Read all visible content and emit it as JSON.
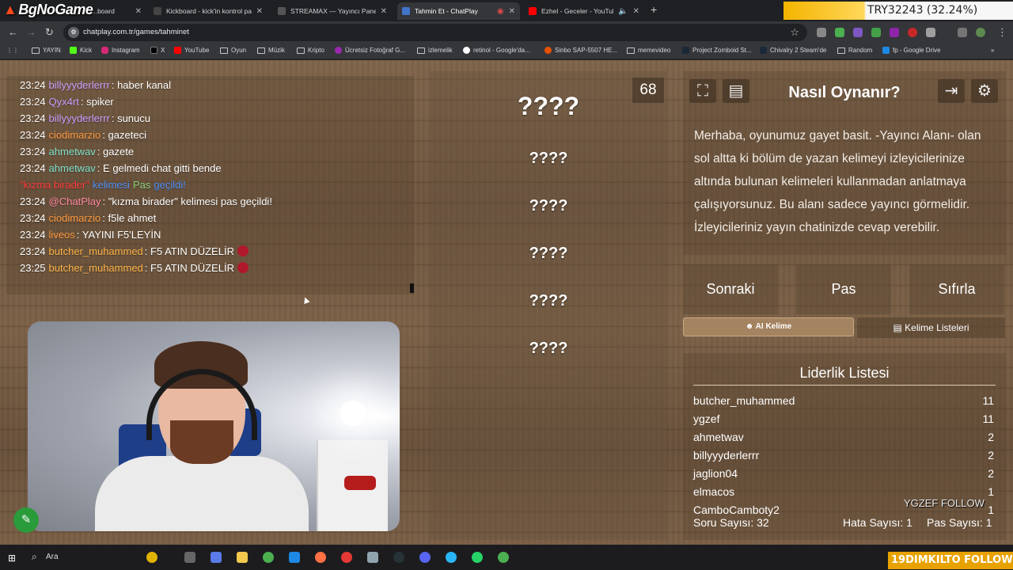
{
  "stream": {
    "brand": "BgNoGame",
    "ticker": "TRY32243 (32.24%)",
    "follow_bar": "19DIMKILTO  FOLLOW",
    "follow_overlay": [
      "YGZEF  FOLLOW"
    ]
  },
  "browser": {
    "tabs": [
      {
        "label": "...board",
        "active": false
      },
      {
        "label": "Kickboard - kick'in kontrol pan",
        "active": false
      },
      {
        "label": "STREAMAX — Yayıncı Paneli",
        "active": false
      },
      {
        "label": "Tahmin Et - ChatPlay",
        "active": true
      },
      {
        "label": "Ezhel - Geceler - YouTube",
        "active": false
      }
    ],
    "url": "chatplay.com.tr/games/tahminet",
    "bookmarks": [
      "YAYIN",
      "Kick",
      "Instagram",
      "X",
      "YouTube",
      "Oyun",
      "Müzik",
      "Kripto",
      "Ücretsiz Fotoğraf G...",
      "izlemelik",
      "retinol - Google'da...",
      "Sinbo SAP-5507 HE...",
      "memevideo",
      "Project Zomboid St...",
      "Chivalry 2 Steam'de",
      "Random",
      "fp - Google Drive"
    ]
  },
  "chat": {
    "messages": [
      {
        "time": "23:24",
        "user": "billyyyderlerrr",
        "color": "#c9a0ff",
        "text": "haber kanal"
      },
      {
        "time": "23:24",
        "user": "Qyx4rt",
        "color": "#c9a0ff",
        "text": "spiker"
      },
      {
        "time": "23:24",
        "user": "billyyyderlerrr",
        "color": "#c9a0ff",
        "text": "sunucu"
      },
      {
        "time": "23:24",
        "user": "ciodimarzio",
        "color": "#ff9b3f",
        "text": "gazeteci"
      },
      {
        "time": "23:24",
        "user": "ahmetwav",
        "color": "#7ee2c9",
        "text": "gazete"
      },
      {
        "time": "23:24",
        "user": "ahmetwav",
        "color": "#7ee2c9",
        "text": "E gelmedi chat gitti bende"
      },
      {
        "system": true,
        "word": "\"kızma birader\"",
        "mid": "kelimesi",
        "status": "Pas",
        "end": "geçildi!"
      },
      {
        "time": "23:24",
        "user": "@ChatPlay",
        "color": "#ff8aa0",
        "text": "\"kızma birader\" kelimesi pas geçildi!"
      },
      {
        "time": "23:24",
        "user": "ciodimarzio",
        "color": "#ff9b3f",
        "text": "f5le ahmet"
      },
      {
        "time": "23:24",
        "user": "liveos",
        "color": "#ff9b3f",
        "text": "YAYINI F5'LEYİN"
      },
      {
        "time": "23:24",
        "user": "butcher_muhammed",
        "color": "#ffb347",
        "text": "F5 ATIN DÜZELİR"
      },
      {
        "time": "23:25",
        "user": "butcher_muhammed",
        "color": "#ffb347",
        "text": "F5 ATIN DÜZELİR"
      }
    ]
  },
  "game": {
    "timer": "68",
    "words": [
      "????",
      "????",
      "????",
      "????",
      "????",
      "????"
    ],
    "howto_title": "Nasıl Oynanır?",
    "howto_text": "Merhaba, oyunumuz gayet basit. -Yayıncı Alanı- olan sol altta ki bölüm de yazan kelimeyi izleyicilerinize altında bulunan kelimeleri kullanmadan anlatmaya çalışıyorsunuz. Bu alanı sadece yayıncı görmelidir. İzleyicileriniz yayın chatinizde cevap verebilir.",
    "buttons": {
      "next": "Sonraki",
      "pass": "Pas",
      "reset": "Sıfırla",
      "ai": "AI Kelime",
      "lists": "Kelime Listeleri"
    },
    "leaderboard": {
      "title": "Liderlik Listesi",
      "rows": [
        {
          "name": "butcher_muhammed",
          "points": "11"
        },
        {
          "name": "ygzef",
          "points": "11"
        },
        {
          "name": "ahmetwav",
          "points": "2"
        },
        {
          "name": "billyyyderlerrr",
          "points": "2"
        },
        {
          "name": "jaglion04",
          "points": "2"
        },
        {
          "name": "elmacos",
          "points": "1"
        },
        {
          "name": "CamboCamboty2",
          "points": "1"
        }
      ],
      "question_count": "Soru Sayısı: 32",
      "error_count": "Hata Sayısı: 1",
      "pass_count": "Pas Sayısı: 1"
    }
  },
  "taskbar": {
    "search": "Ara"
  }
}
